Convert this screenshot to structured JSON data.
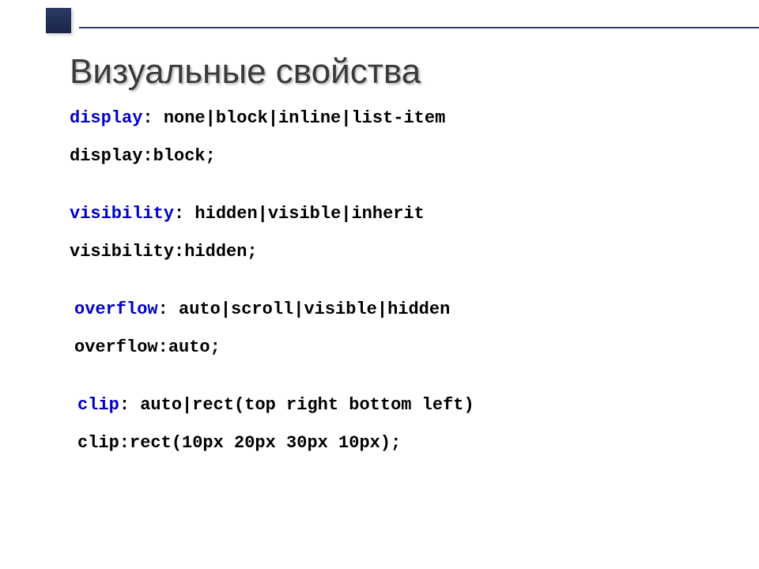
{
  "slide": {
    "title": "Визуальные свойства",
    "blocks": [
      {
        "prop": "display",
        "def_tail": ": none|block|inline|list-item",
        "example": "display:block;",
        "shift": ""
      },
      {
        "prop": "visibility",
        "def_tail": ": hidden|visible|inherit",
        "example": "visibility:hidden;",
        "shift": ""
      },
      {
        "prop": "overflow",
        "def_tail": ": auto|scroll|visible|hidden",
        "example": "overflow:auto;",
        "shift": "shift1"
      },
      {
        "prop": "clip",
        "def_tail": ": auto|rect(top right bottom left)",
        "example": "clip:rect(10px 20px 30px 10px);",
        "shift": "shift2"
      }
    ]
  }
}
